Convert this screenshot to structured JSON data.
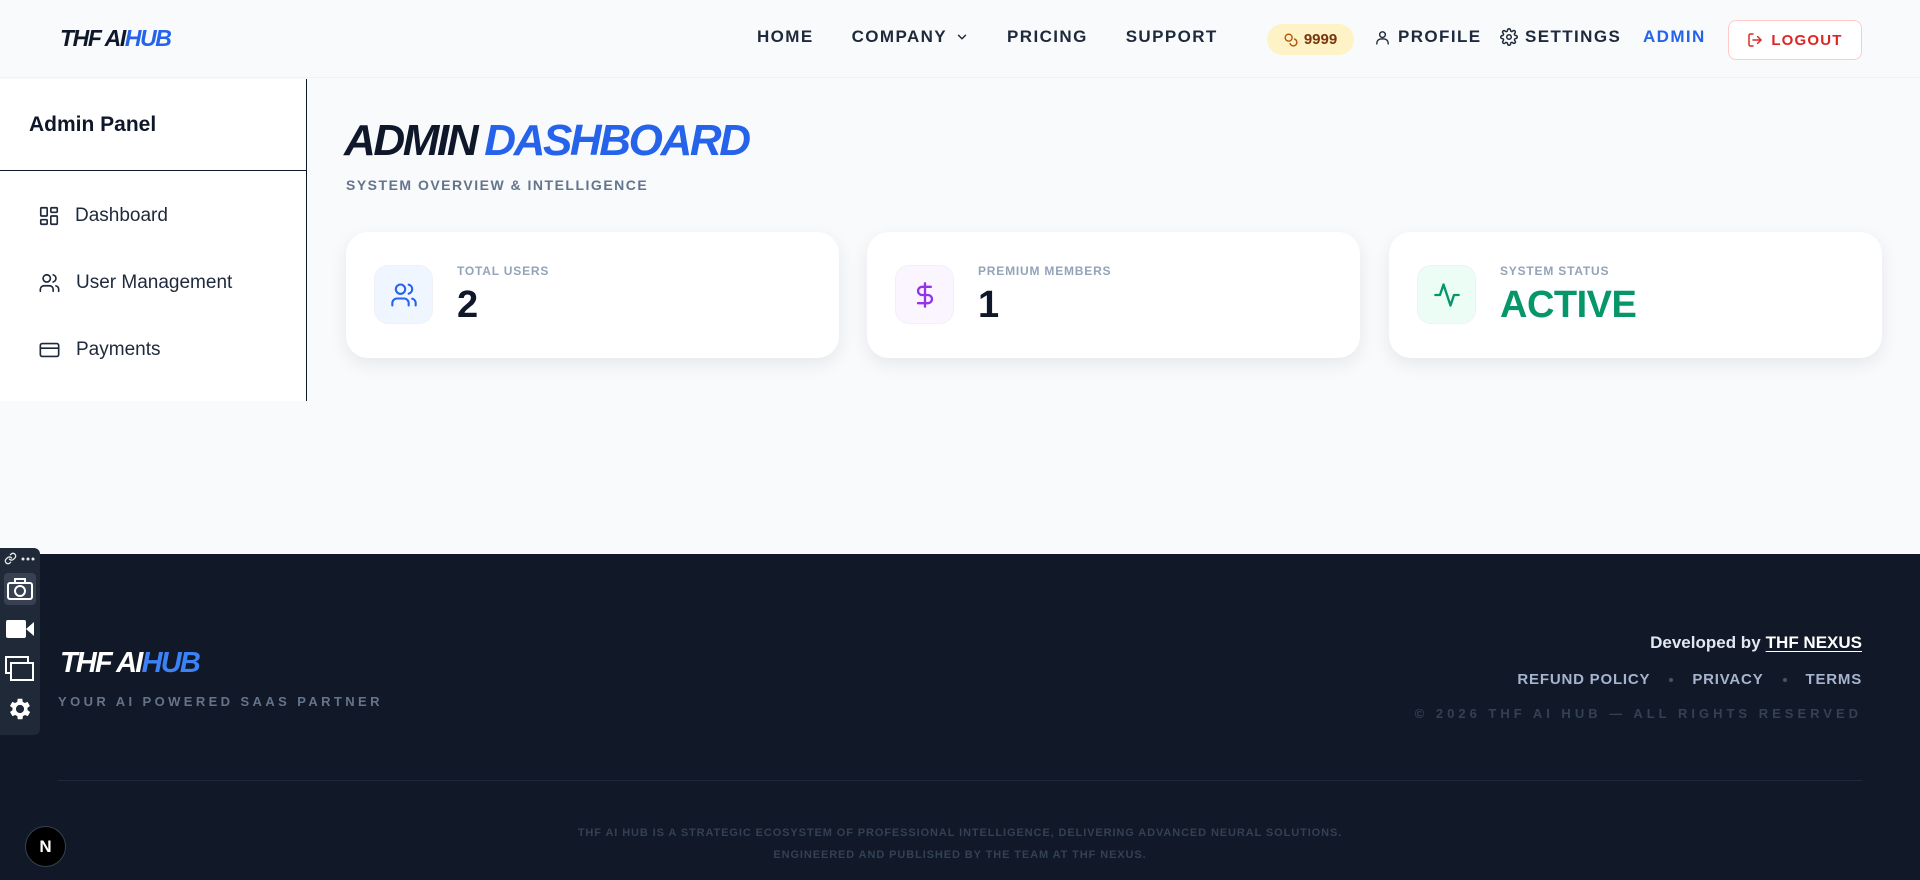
{
  "header": {
    "logo": {
      "part1": "THF AI",
      "part2": "HUB"
    },
    "nav": {
      "home": "HOME",
      "company": "COMPANY",
      "pricing": "PRICING",
      "support": "SUPPORT"
    },
    "credits": "9999",
    "profile": "PROFILE",
    "settings": "SETTINGS",
    "admin": "ADMIN",
    "logout": "LOGOUT"
  },
  "sidebar": {
    "title": "Admin Panel",
    "items": [
      {
        "label": "Dashboard",
        "icon": "dashboard-grid-icon"
      },
      {
        "label": "User Management",
        "icon": "users-icon"
      },
      {
        "label": "Payments",
        "icon": "credit-card-icon"
      }
    ]
  },
  "main": {
    "title": {
      "part1": "ADMIN",
      "part2": "DASHBOARD"
    },
    "subtitle": "SYSTEM OVERVIEW & INTELLIGENCE",
    "cards": [
      {
        "label": "TOTAL USERS",
        "value": "2",
        "icon": "users-icon",
        "color": "#2563eb"
      },
      {
        "label": "PREMIUM MEMBERS",
        "value": "1",
        "icon": "dollar-icon",
        "color": "#9333ea"
      },
      {
        "label": "SYSTEM STATUS",
        "value": "ACTIVE",
        "icon": "activity-icon",
        "color": "#059669"
      }
    ]
  },
  "footer": {
    "logo": {
      "part1": "THF AI",
      "part2": "HUB"
    },
    "tagline": "YOUR AI POWERED SAAS PARTNER",
    "developed_by": "Developed by",
    "developer": "THF NEXUS",
    "links": [
      "REFUND POLICY",
      "PRIVACY",
      "TERMS"
    ],
    "copyright": "© 2026 THF AI HUB — ALL RIGHTS RESERVED",
    "note_line1": "THF AI HUB IS A STRATEGIC ECOSYSTEM OF PROFESSIONAL INTELLIGENCE, DELIVERING ADVANCED NEURAL SOLUTIONS.",
    "note_line2": "ENGINEERED AND PUBLISHED BY THE TEAM AT THF NEXUS."
  },
  "devtools": {
    "badge": "N"
  },
  "colors": {
    "accent": "#2563eb",
    "danger": "#dc2626",
    "footer_bg": "#111827",
    "success": "#059669",
    "credits_bg": "#fef3c7"
  }
}
